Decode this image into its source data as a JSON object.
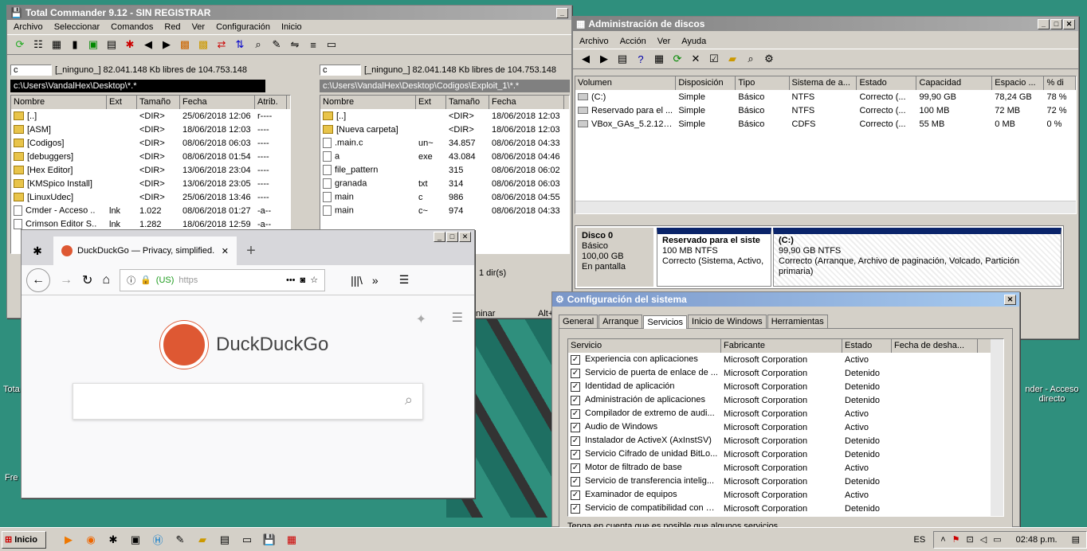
{
  "tc": {
    "title": "Total Commander 9.12 - SIN REGISTRAR",
    "menu": [
      "Archivo",
      "Seleccionar",
      "Comandos",
      "Red",
      "Ver",
      "Configuración",
      "Inicio"
    ],
    "left": {
      "drive": "c",
      "free": "[_ninguno_]  82.041.148 Kb libres de 104.753.148",
      "path": "c:\\Users\\VandalHex\\Desktop\\*.*",
      "cols": [
        "Nombre",
        "Ext",
        "Tamaño",
        "Fecha",
        "Atrib."
      ],
      "rows": [
        [
          "[..]",
          "",
          "<DIR>",
          "25/06/2018 12:06",
          "r----"
        ],
        [
          "[ASM]",
          "",
          "<DIR>",
          "18/06/2018 12:03",
          "----"
        ],
        [
          "[Codigos]",
          "",
          "<DIR>",
          "08/06/2018 06:03",
          "----"
        ],
        [
          "[debuggers]",
          "",
          "<DIR>",
          "08/06/2018 01:54",
          "----"
        ],
        [
          "[Hex Editor]",
          "",
          "<DIR>",
          "13/06/2018 23:04",
          "----"
        ],
        [
          "[KMSpico Install]",
          "",
          "<DIR>",
          "13/06/2018 23:05",
          "----"
        ],
        [
          "[LinuxUdec]",
          "",
          "<DIR>",
          "25/06/2018 13:46",
          "----"
        ],
        [
          "Cmder - Acceso ..",
          "lnk",
          "1.022",
          "08/06/2018 01:27",
          "-a--"
        ],
        [
          "Crimson Editor S..",
          "lnk",
          "1.282",
          "18/06/2018 12:59",
          "-a--"
        ]
      ]
    },
    "right": {
      "drive": "c",
      "free": "[_ninguno_]  82.041.148 Kb libres de 104.753.148",
      "path": "c:\\Users\\VandalHex\\Desktop\\Codigos\\Exploit_1\\*.*",
      "cols": [
        "Nombre",
        "Ext",
        "Tamaño",
        "Fecha"
      ],
      "rows": [
        [
          "[..]",
          "",
          "<DIR>",
          "18/06/2018 12:03"
        ],
        [
          "[Nueva carpeta]",
          "",
          "<DIR>",
          "18/06/2018 12:03"
        ],
        [
          ".main.c",
          "un~",
          "34.857",
          "08/06/2018 04:33"
        ],
        [
          "a",
          "exe",
          "43.084",
          "08/06/2018 04:46"
        ],
        [
          "file_pattern",
          "",
          "315",
          "08/06/2018 06:02"
        ],
        [
          "granada",
          "txt",
          "314",
          "08/06/2018 06:03"
        ],
        [
          "main",
          "c",
          "986",
          "08/06/2018 04:55"
        ],
        [
          "main",
          "c~",
          "974",
          "08/06/2018 04:33"
        ]
      ]
    },
    "status_right": "1 dir(s)",
    "fn_left": "ninar",
    "fn_right": "Alt+"
  },
  "disk": {
    "title": "Administración de discos",
    "menu": [
      "Archivo",
      "Acción",
      "Ver",
      "Ayuda"
    ],
    "cols": [
      "Volumen",
      "Disposición",
      "Tipo",
      "Sistema de a...",
      "Estado",
      "Capacidad",
      "Espacio ...",
      "% di"
    ],
    "rows": [
      [
        "(C:)",
        "Simple",
        "Básico",
        "NTFS",
        "Correcto (...",
        "99,90 GB",
        "78,24 GB",
        "78 %"
      ],
      [
        "Reservado para el ...",
        "Simple",
        "Básico",
        "NTFS",
        "Correcto (...",
        "100 MB",
        "72 MB",
        "72 %"
      ],
      [
        "VBox_GAs_5.2.12 (...",
        "Simple",
        "Básico",
        "CDFS",
        "Correcto (...",
        "55 MB",
        "0 MB",
        "0 %"
      ]
    ],
    "disk0": {
      "name": "Disco 0",
      "type": "Básico",
      "size": "100,00 GB",
      "status": "En pantalla"
    },
    "p1": {
      "name": "Reservado para el siste",
      "size": "100 MB NTFS",
      "status": "Correcto (Sistema, Activo,"
    },
    "p2": {
      "name": "(C:)",
      "size": "99,90 GB NTFS",
      "status": "Correcto (Arranque, Archivo de paginación, Volcado, Partición primaria)"
    }
  },
  "msc": {
    "title": "Configuración del sistema",
    "tabs": [
      "General",
      "Arranque",
      "Servicios",
      "Inicio de Windows",
      "Herramientas"
    ],
    "cols": [
      "Servicio",
      "Fabricante",
      "Estado",
      "Fecha de desha..."
    ],
    "rows": [
      [
        "Experiencia con aplicaciones",
        "Microsoft Corporation",
        "Activo"
      ],
      [
        "Servicio de puerta de enlace de ...",
        "Microsoft Corporation",
        "Detenido"
      ],
      [
        "Identidad de aplicación",
        "Microsoft Corporation",
        "Detenido"
      ],
      [
        "Administración de aplicaciones",
        "Microsoft Corporation",
        "Detenido"
      ],
      [
        "Compilador de extremo de audi...",
        "Microsoft Corporation",
        "Activo"
      ],
      [
        "Audio de Windows",
        "Microsoft Corporation",
        "Activo"
      ],
      [
        "Instalador de ActiveX (AxInstSV)",
        "Microsoft Corporation",
        "Detenido"
      ],
      [
        "Servicio Cifrado de unidad BitLo...",
        "Microsoft Corporation",
        "Detenido"
      ],
      [
        "Motor de filtrado de base",
        "Microsoft Corporation",
        "Activo"
      ],
      [
        "Servicio de transferencia intelig...",
        "Microsoft Corporation",
        "Detenido"
      ],
      [
        "Examinador de equipos",
        "Microsoft Corporation",
        "Activo"
      ],
      [
        "Servicio de compatibilidad con Bl...",
        "Microsoft Corporation",
        "Detenido"
      ]
    ],
    "note": "Tenga en cuenta que es posible que algunos servicios"
  },
  "ff": {
    "tab": "DuckDuckGo — Privacy, simplified.",
    "url_us": "(US)",
    "url": "https",
    "brand": "DuckDuckGo"
  },
  "desktop": {
    "l1": "Tota",
    "l2": "Fre",
    "r1": "nder - Acceso",
    "r2": "directo"
  },
  "taskbar": {
    "start": "Inicio",
    "lang": "ES",
    "clock": "02:48 p.m."
  }
}
